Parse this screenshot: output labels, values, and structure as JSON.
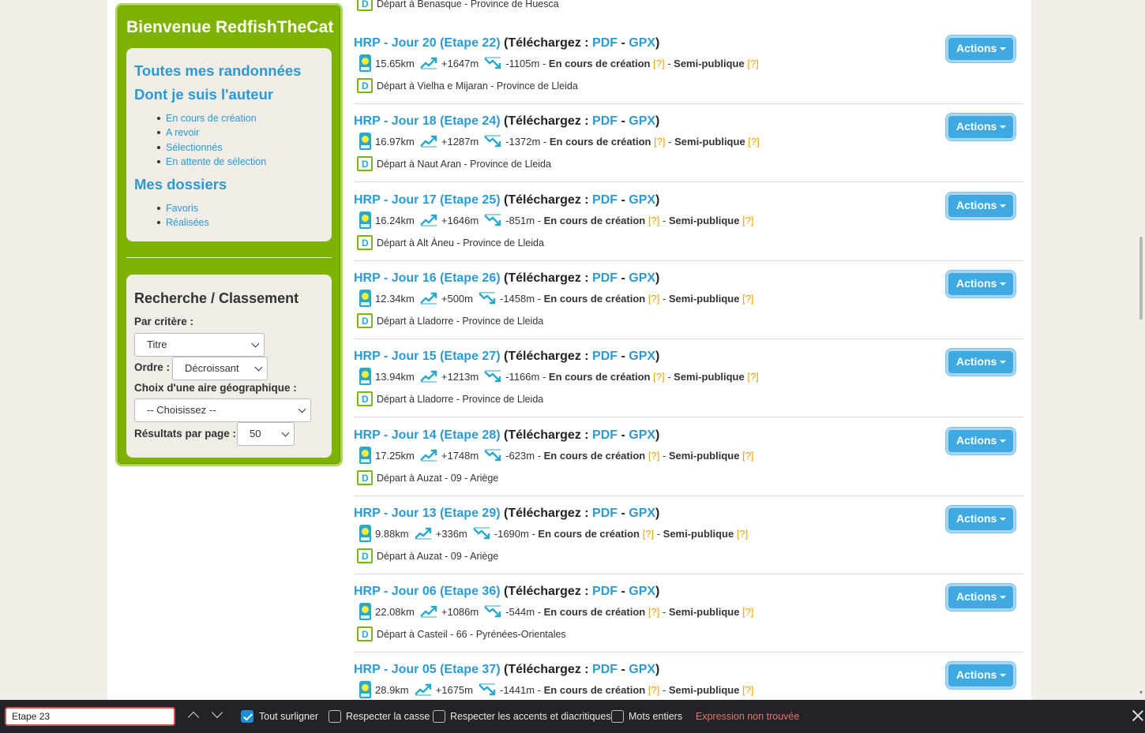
{
  "sidebar": {
    "welcome": "Bienvenue RedfishTheCat",
    "all_hikes": "Toutes mes randonnées",
    "author_heading": "Dont je suis l'auteur",
    "author_items": [
      "En cours de création",
      "A revoir",
      "Sélectionnés",
      "En attente de sélection"
    ],
    "folders_heading": "Mes dossiers",
    "folder_items": [
      "Favoris",
      "Réalisées"
    ],
    "search_title": "Recherche / Classement",
    "criteria_label": "Par critère :",
    "criteria_value": "Titre",
    "order_label": "Ordre :",
    "order_value": "Décroissant",
    "area_label": "Choix d'une aire géographique :",
    "area_value": "-- Choisissez --",
    "per_page_label": "Résultats par page :",
    "per_page_value": "50"
  },
  "top_partial": "Départ à Benasque - Province de Huesca",
  "hikes": [
    {
      "title": "HRP - Jour 20 (Etape 22)",
      "dist": "15.65km",
      "up": "+1647m",
      "down": "-1105m",
      "depart": "Départ à Vielha e Mijaran - Province de Lleida"
    },
    {
      "title": "HRP - Jour 18 (Etape 24)",
      "dist": "16.97km",
      "up": "+1287m",
      "down": "-1372m",
      "depart": "Départ à Naut Aran - Province de Lleida"
    },
    {
      "title": "HRP - Jour 17 (Etape 25)",
      "dist": "16.24km",
      "up": "+1646m",
      "down": "-851m",
      "depart": "Départ à Alt Àneu - Province de Lleida"
    },
    {
      "title": "HRP - Jour 16 (Etape 26)",
      "dist": "12.34km",
      "up": "+500m",
      "down": "-1458m",
      "depart": "Départ à Lladorre - Province de Lleida"
    },
    {
      "title": "HRP - Jour 15 (Etape 27)",
      "dist": "13.94km",
      "up": "+1213m",
      "down": "-1166m",
      "depart": "Départ à Lladorre - Province de Lleida"
    },
    {
      "title": "HRP - Jour 14 (Etape 28)",
      "dist": "17.25km",
      "up": "+1748m",
      "down": "-623m",
      "depart": "Départ à Auzat - 09 - Ariège"
    },
    {
      "title": "HRP - Jour 13 (Etape 29)",
      "dist": "9.88km",
      "up": "+336m",
      "down": "-1690m",
      "depart": "Départ à Auzat - 09 - Ariège"
    },
    {
      "title": "HRP - Jour 06 (Etape 36)",
      "dist": "22.08km",
      "up": "+1086m",
      "down": "-544m",
      "depart": "Départ à Casteil - 66 - Pyrénées-Orientales"
    },
    {
      "title": "HRP - Jour 05 (Etape 37)",
      "dist": "28.9km",
      "up": "+1675m",
      "down": "-1441m",
      "depart": ""
    }
  ],
  "labels": {
    "download_open": "(Téléchargez : ",
    "pdf": "PDF",
    "sep": " - ",
    "gpx": "GPX",
    "close_paren": ")",
    "status": "En cours de création",
    "help": "[?]",
    "visibility": "Semi-publique",
    "actions": "Actions"
  },
  "findbar": {
    "query": "Etape 23",
    "highlight_all": "Tout surligner",
    "match_case": "Respecter la casse",
    "match_diacritics": "Respecter les accents et diacritiques",
    "whole_words": "Mots entiers",
    "status": "Expression non trouvée"
  },
  "colors": {
    "accent": "#2b9ad1",
    "sidebar_green": "#7db300",
    "help_orange": "#e8a100",
    "button_blue": "#3fa9e2"
  }
}
